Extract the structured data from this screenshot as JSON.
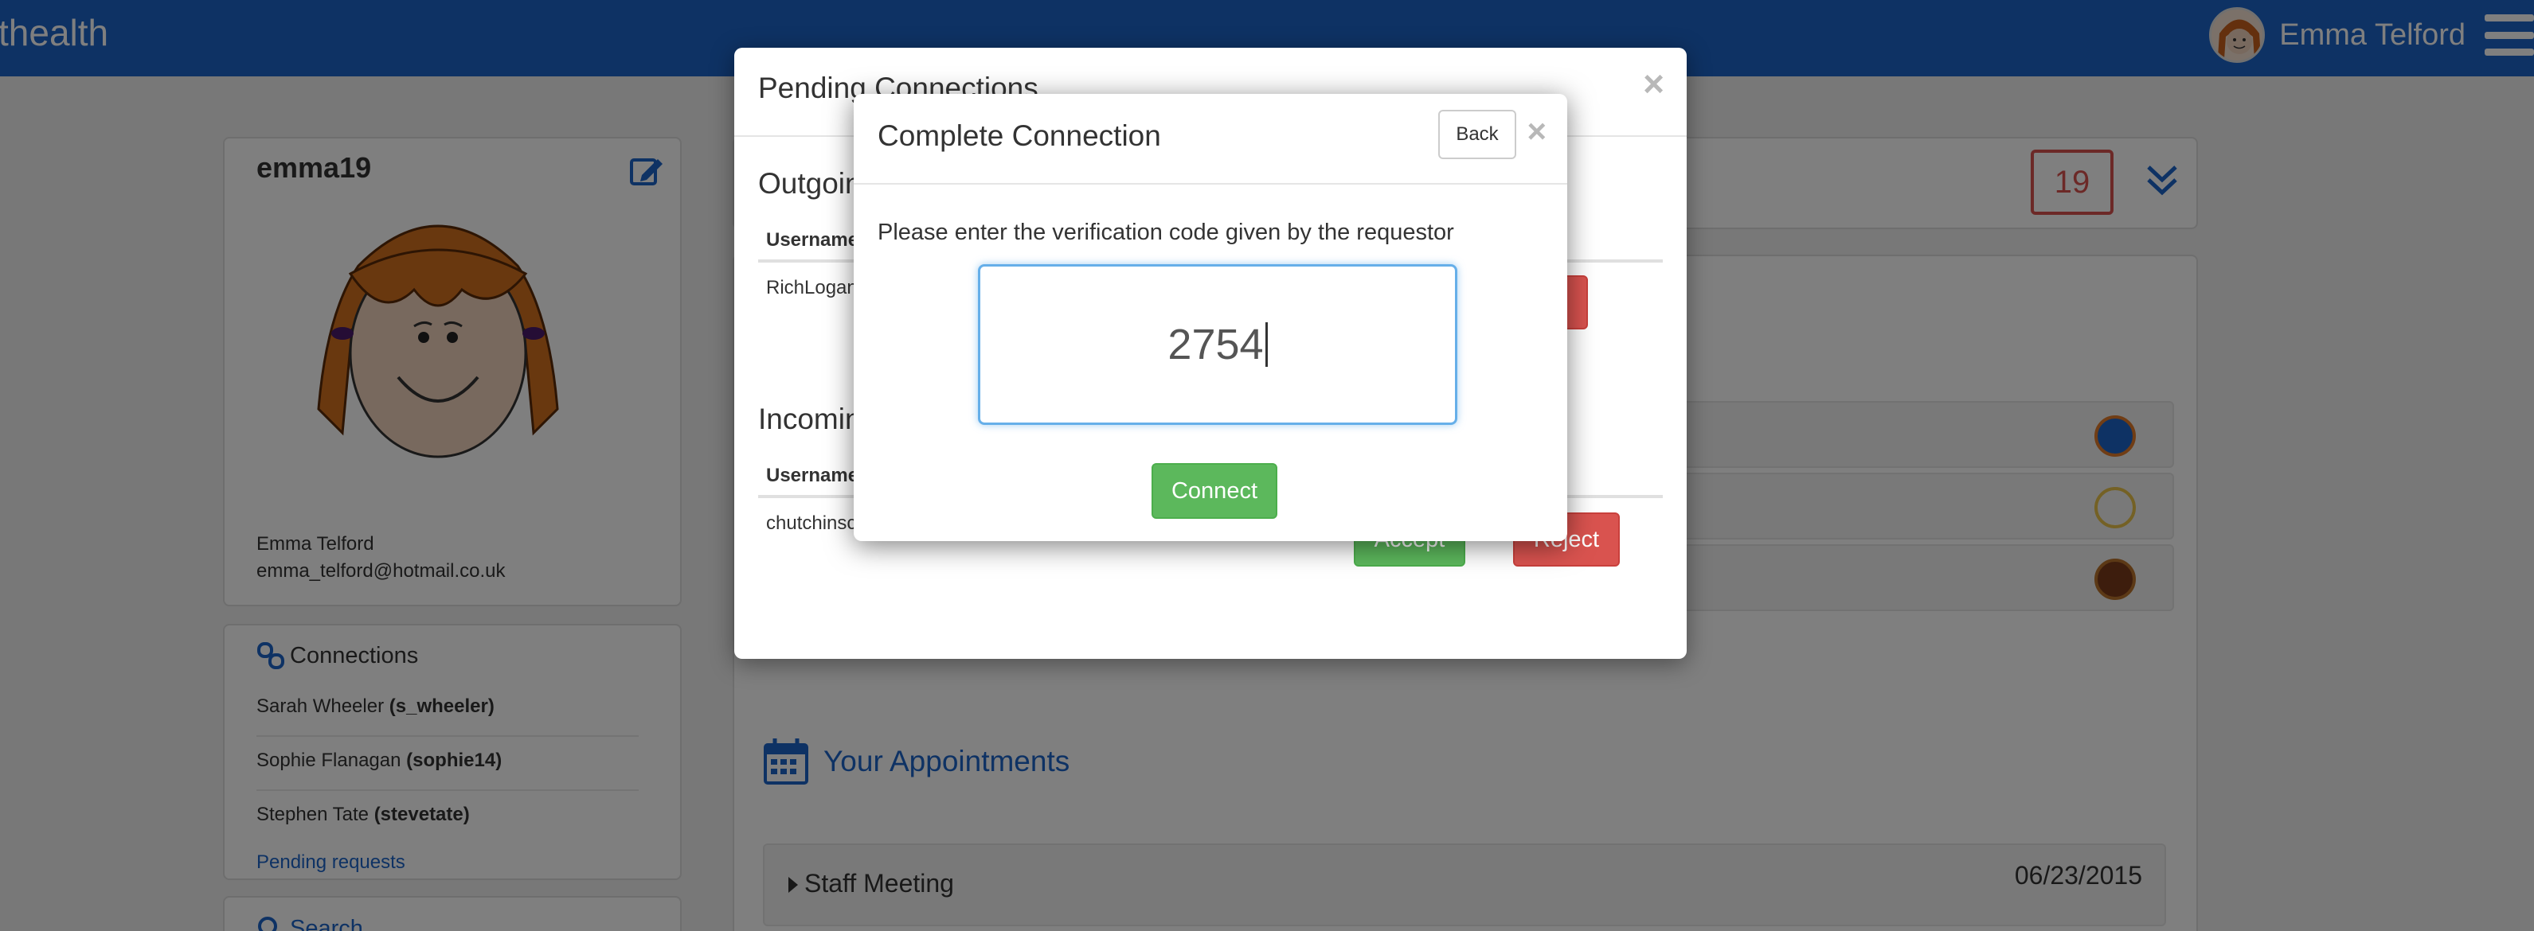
{
  "app": {
    "brand": "thealth",
    "user_name": "Emma Telford"
  },
  "profile": {
    "username": "emma19",
    "full_name": "Emma Telford",
    "email": "emma_telford@hotmail.co.uk"
  },
  "connections": {
    "title": "Connections",
    "items": [
      {
        "name": "Sarah Wheeler",
        "handle": "(s_wheeler)"
      },
      {
        "name": "Sophie Flanagan",
        "handle": "(sophie14)"
      },
      {
        "name": "Stephen Tate",
        "handle": "(stevetate)"
      }
    ],
    "pending_link": "Pending requests"
  },
  "search": {
    "title": "Search"
  },
  "notifications": {
    "count": "19"
  },
  "appointments": {
    "title": "Your Appointments",
    "items": [
      {
        "name": "Staff Meeting",
        "date": "06/23/2015"
      }
    ]
  },
  "pending_modal": {
    "title": "Pending Connections",
    "close": "×",
    "outgoing_title": "Outgoin",
    "incoming_title": "Incomin",
    "username_header": "Username",
    "outgoing_user": "RichLogan",
    "incoming_user": "chutchinsc",
    "accept_label": "Accept",
    "reject_label": "Reject"
  },
  "complete_modal": {
    "title": "Complete Connection",
    "back_label": "Back",
    "close": "×",
    "instructions": "Please enter the verification code given by the requestor",
    "code_value": "2754",
    "connect_label": "Connect"
  },
  "colors": {
    "primary": "#1c64c9",
    "danger": "#d9534f",
    "success": "#5cb85c"
  }
}
